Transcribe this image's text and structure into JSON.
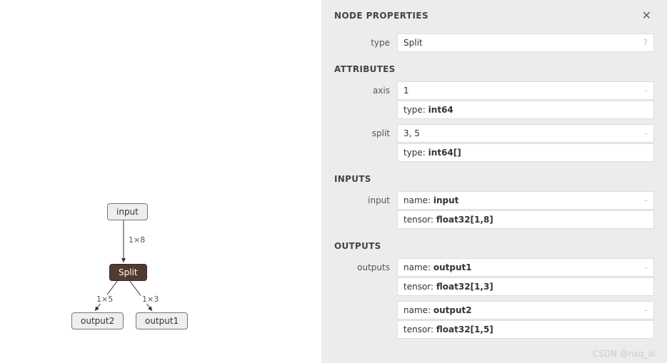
{
  "panel": {
    "title": "NODE PROPERTIES",
    "type_label": "type",
    "type_value": "Split",
    "type_hint": "?",
    "attributes_title": "ATTRIBUTES",
    "inputs_title": "INPUTS",
    "outputs_title": "OUTPUTS",
    "attrs": {
      "axis_label": "axis",
      "axis_value": "1",
      "axis_type_prefix": "type: ",
      "axis_type": "int64",
      "split_label": "split",
      "split_value": "3, 5",
      "split_type_prefix": "type: ",
      "split_type": "int64[]"
    },
    "inputs": {
      "input_label": "input",
      "name_prefix": "name: ",
      "input_name": "input",
      "tensor_prefix": "tensor: ",
      "input_tensor": "float32[1,8]"
    },
    "outputs": {
      "outputs_label": "outputs",
      "o1_name": "output1",
      "o1_tensor": "float32[1,3]",
      "o2_name": "output2",
      "o2_tensor": "float32[1,5]"
    }
  },
  "graph": {
    "input_label": "input",
    "split_label": "Split",
    "output1_label": "output1",
    "output2_label": "output2",
    "edge_top": "1×8",
    "edge_left": "1×5",
    "edge_right": "1×3"
  },
  "watermark": "CSDN @nsq_ai"
}
